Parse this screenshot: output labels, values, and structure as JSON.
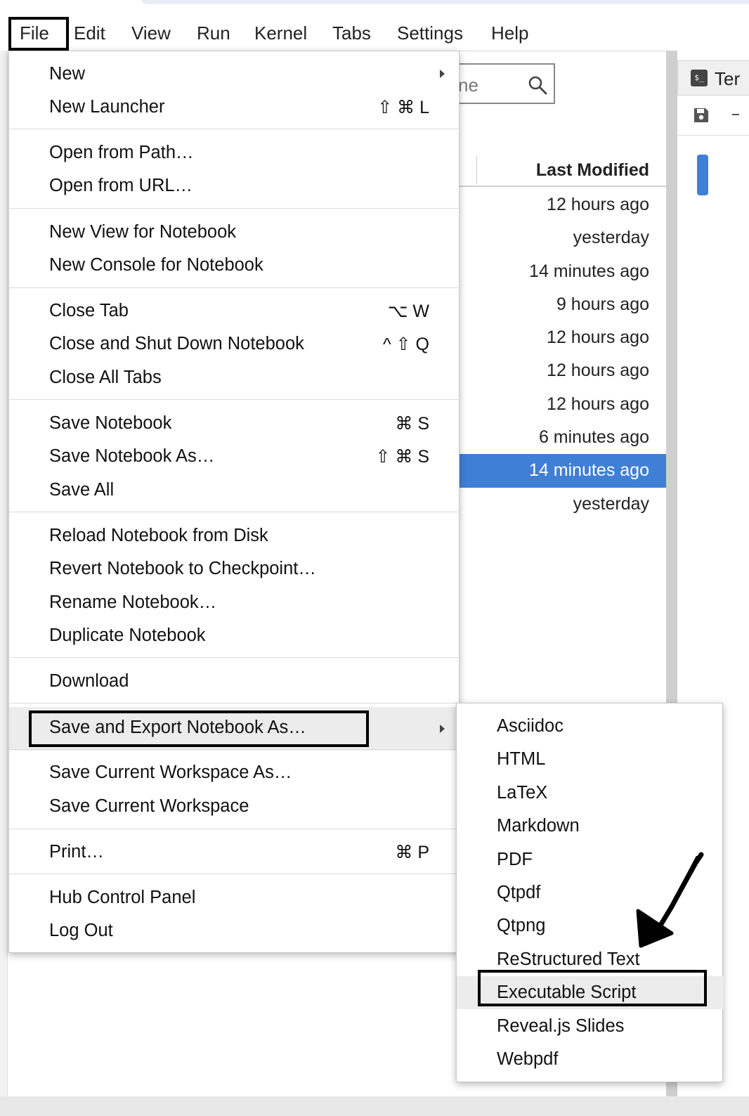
{
  "menubar": {
    "items": [
      "File",
      "Edit",
      "View",
      "Run",
      "Kernel",
      "Tabs",
      "Settings",
      "Help"
    ]
  },
  "file_browser": {
    "search_placeholder": "ne",
    "column_header": "Last Modified",
    "rows": [
      "12 hours ago",
      "yesterday",
      "14 minutes ago",
      "9 hours ago",
      "12 hours ago",
      "12 hours ago",
      "12 hours ago",
      "6 minutes ago",
      "14 minutes ago",
      "yesterday"
    ],
    "selected_row": 8
  },
  "right_panel": {
    "tab_label": "Ter",
    "terminal_icon_text": "$_"
  },
  "file_menu": {
    "items": [
      {
        "label": "New",
        "shortcut": "",
        "submenu": true
      },
      {
        "label": "New Launcher",
        "shortcut": "⇧ ⌘ L"
      },
      {
        "label": "Open from Path…",
        "shortcut": ""
      },
      {
        "label": "Open from URL…",
        "shortcut": ""
      },
      {
        "label": "New View for Notebook",
        "shortcut": ""
      },
      {
        "label": "New Console for Notebook",
        "shortcut": ""
      },
      {
        "label": "Close Tab",
        "shortcut": "⌥ W"
      },
      {
        "label": "Close and Shut Down Notebook",
        "shortcut": "^ ⇧ Q"
      },
      {
        "label": "Close All Tabs",
        "shortcut": ""
      },
      {
        "label": "Save Notebook",
        "shortcut": "⌘ S"
      },
      {
        "label": "Save Notebook As…",
        "shortcut": "⇧ ⌘ S"
      },
      {
        "label": "Save All",
        "shortcut": ""
      },
      {
        "label": "Reload Notebook from Disk",
        "shortcut": ""
      },
      {
        "label": "Revert Notebook to Checkpoint…",
        "shortcut": ""
      },
      {
        "label": "Rename Notebook…",
        "shortcut": ""
      },
      {
        "label": "Duplicate Notebook",
        "shortcut": ""
      },
      {
        "label": "Download",
        "shortcut": ""
      },
      {
        "label": "Save and Export Notebook As…",
        "shortcut": "",
        "submenu": true
      },
      {
        "label": "Save Current Workspace As…",
        "shortcut": ""
      },
      {
        "label": "Save Current Workspace",
        "shortcut": ""
      },
      {
        "label": "Print…",
        "shortcut": "⌘ P"
      },
      {
        "label": "Hub Control Panel",
        "shortcut": ""
      },
      {
        "label": "Log Out",
        "shortcut": ""
      }
    ]
  },
  "export_submenu": {
    "items": [
      "Asciidoc",
      "HTML",
      "LaTeX",
      "Markdown",
      "PDF",
      "Qtpdf",
      "Qtpng",
      "ReStructured Text",
      "Executable Script",
      "Reveal.js Slides",
      "Webpdf"
    ],
    "highlighted_index": 8
  }
}
